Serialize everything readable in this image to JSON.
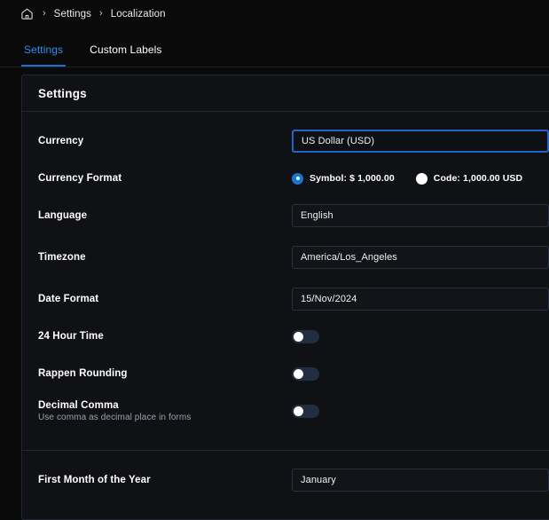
{
  "breadcrumb": {
    "home_icon": "home-icon",
    "separator": "›",
    "items": [
      "Settings",
      "Localization"
    ]
  },
  "tabs": [
    {
      "label": "Settings",
      "active": true
    },
    {
      "label": "Custom Labels",
      "active": false
    }
  ],
  "card": {
    "title": "Settings",
    "rows": {
      "currency": {
        "label": "Currency",
        "value": "US Dollar (USD)",
        "focused": true
      },
      "currency_format": {
        "label": "Currency Format",
        "options": [
          {
            "label": "Symbol: $ 1,000.00",
            "checked": true
          },
          {
            "label": "Code: 1,000.00 USD",
            "checked": false
          }
        ]
      },
      "language": {
        "label": "Language",
        "value": "English"
      },
      "timezone": {
        "label": "Timezone",
        "value": "America/Los_Angeles"
      },
      "date_format": {
        "label": "Date Format",
        "value": "15/Nov/2024"
      },
      "hour_24": {
        "label": "24 Hour Time",
        "state": "off"
      },
      "rappen_rounding": {
        "label": "Rappen Rounding",
        "state": "off"
      },
      "decimal_comma": {
        "label": "Decimal Comma",
        "sublabel": "Use comma as decimal place in forms",
        "state": "off"
      },
      "first_month": {
        "label": "First Month of the Year",
        "value": "January"
      }
    }
  },
  "colors": {
    "page_bg": "#0a0a0a",
    "card_bg": "#101114",
    "border": "#222733",
    "accent_blue": "#2e8fe8",
    "focus_blue": "#2563c9",
    "radio_blue": "#1676d4",
    "toggle_track": "#222d41"
  }
}
